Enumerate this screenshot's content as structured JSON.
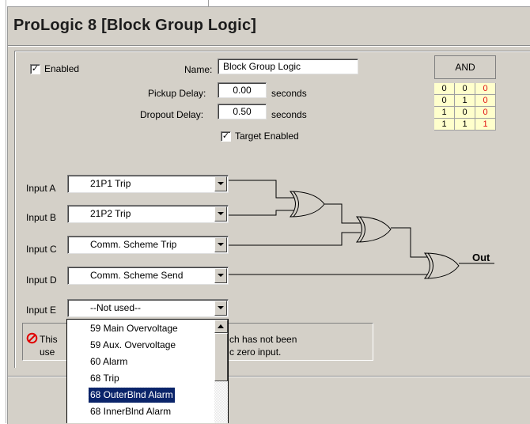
{
  "title": "ProLogic 8 [Block Group Logic]",
  "enabled": {
    "label": "Enabled",
    "checked": true
  },
  "name_field": {
    "label": "Name:",
    "value": "Block Group Logic"
  },
  "pickup_delay": {
    "label": "Pickup Delay:",
    "value": "0.00",
    "unit": "seconds"
  },
  "dropout_delay": {
    "label": "Dropout Delay:",
    "value": "0.50",
    "unit": "seconds"
  },
  "target_enabled": {
    "label": "Target Enabled",
    "checked": true
  },
  "truth_table": {
    "header": "AND",
    "rows": [
      [
        "0",
        "0",
        "0"
      ],
      [
        "0",
        "1",
        "0"
      ],
      [
        "1",
        "0",
        "0"
      ],
      [
        "1",
        "1",
        "1"
      ]
    ]
  },
  "inputs": [
    {
      "label": "Input A",
      "value": "21P1 Trip"
    },
    {
      "label": "Input B",
      "value": "21P2 Trip"
    },
    {
      "label": "Input C",
      "value": "Comm. Scheme Trip"
    },
    {
      "label": "Input D",
      "value": "Comm. Scheme Send"
    },
    {
      "label": "Input E",
      "value": "--Not used--"
    }
  ],
  "output_label": "Out",
  "message": {
    "left_line1": "This",
    "left_line2": "use",
    "right_line1": "ch has not been",
    "right_line2": "c zero input."
  },
  "dropdown_options": [
    "59 Main Overvoltage",
    "59 Aux. Overvoltage",
    "60 Alarm",
    "68 Trip",
    "68 OuterBlnd Alarm",
    "68 InnerBlnd Alarm"
  ],
  "dropdown_selected_index": 4,
  "colors": {
    "panel": "#d4d0c8",
    "truth_cell": "#ffffcc",
    "truth_output": "#e01010",
    "selection": "#0a246a"
  }
}
